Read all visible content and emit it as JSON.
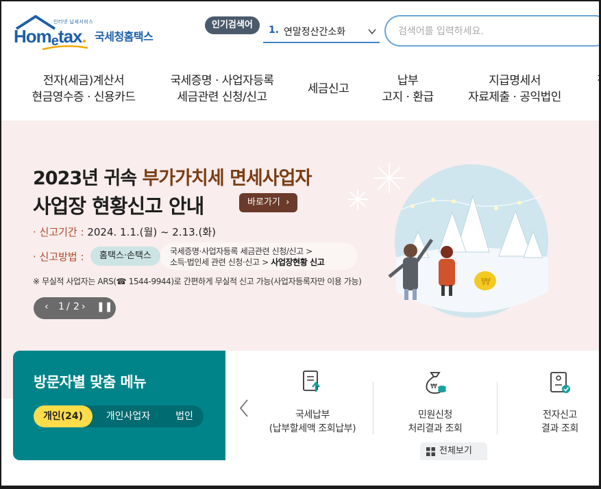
{
  "header": {
    "logo": {
      "tagline": "인터넷 납세서비스",
      "wordmark_pre": "Hom",
      "wordmark_e": "e",
      "wordmark_post": "tax",
      "wordmark_dot": ".",
      "korean": "국세청홈택스"
    },
    "popular_search": {
      "badge": "인기검색어",
      "rank": "1.",
      "term": "연말정산간소화"
    },
    "search": {
      "placeholder": "검색어를 입력하세요."
    }
  },
  "nav": {
    "items": [
      {
        "line1": "전자(세금)계산서",
        "line2": "현금영수증 · 신용카드"
      },
      {
        "line1": "국세증명 · 사업자등록",
        "line2": "세금관련 신청/신고"
      },
      {
        "line1": "세금신고",
        "line2": ""
      },
      {
        "line1": "납부",
        "line2": "고지 · 환급"
      },
      {
        "line1": "지급명세서",
        "line2": "자료제출 · 공익법인"
      },
      {
        "line1": "장",
        "line2": ""
      }
    ]
  },
  "banner": {
    "title1_pre": "2023년 귀속 ",
    "title1_highlight": "부가가치세 면세사업자",
    "title2": "사업장 현황신고 안내",
    "shortcut_button": "바로가기",
    "period_label": "· 신고기간 :",
    "period_value": "2024. 1.1.(월) ~ 2.13.(화)",
    "method_label": "· 신고방법 :",
    "method_pill": "홈택스·손택스",
    "method_path1": "국세증명·사업자등록 세금관련 신청/신고 >",
    "method_path2_pre": "소득·법인세 관련 신청·신고 > ",
    "method_path2_bold": "사업장현황 신고",
    "note": "※ 무실적 사업자는 ARS(☎ 1544-9944)로 간편하게 무실적 신고 가능(사업자등록자만 이용 가능)",
    "pager": {
      "current": "1",
      "separator": "/",
      "total": "2"
    }
  },
  "visitor_menu": {
    "title": "방문자별 맞춤 메뉴",
    "tabs": [
      "개인(24)",
      "개인사업자",
      "법인"
    ]
  },
  "quick_menu": {
    "items": [
      {
        "icon": "tax-payment-icon",
        "line1": "국세납부",
        "line2": "(납부할세액 조회납부)"
      },
      {
        "icon": "money-bag-icon",
        "line1": "민원신청",
        "line2": "처리결과 조회"
      },
      {
        "icon": "e-filing-icon",
        "line1": "전자신고",
        "line2": "결과 조회"
      }
    ],
    "view_all": "전체보기"
  },
  "colors": {
    "brand_blue": "#1d5fa8",
    "banner_bg": "#f9eded",
    "visitor_teal": "#00848a",
    "active_tab_yellow": "#ffdc4a"
  }
}
